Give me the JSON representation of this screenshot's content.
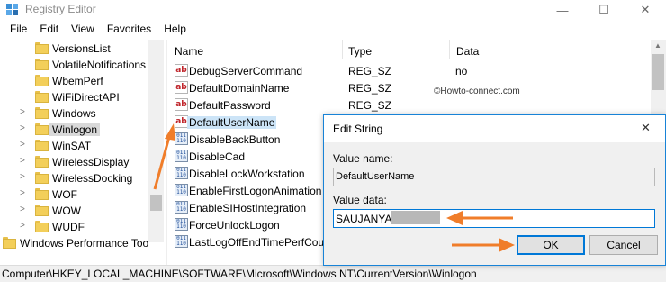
{
  "window": {
    "title": "Registry Editor",
    "controls": {
      "minimize": "—",
      "maximize": "☐",
      "close": "✕"
    }
  },
  "menu": [
    "File",
    "Edit",
    "View",
    "Favorites",
    "Help"
  ],
  "tree": {
    "items": [
      {
        "label": "VersionsList",
        "expandable": false,
        "selected": false
      },
      {
        "label": "VolatileNotifications",
        "expandable": false,
        "selected": false
      },
      {
        "label": "WbemPerf",
        "expandable": false,
        "selected": false
      },
      {
        "label": "WiFiDirectAPI",
        "expandable": false,
        "selected": false
      },
      {
        "label": "Windows",
        "expandable": true,
        "selected": false
      },
      {
        "label": "Winlogon",
        "expandable": true,
        "selected": true
      },
      {
        "label": "WinSAT",
        "expandable": true,
        "selected": false
      },
      {
        "label": "WirelessDisplay",
        "expandable": true,
        "selected": false
      },
      {
        "label": "WirelessDocking",
        "expandable": true,
        "selected": false
      },
      {
        "label": "WOF",
        "expandable": true,
        "selected": false
      },
      {
        "label": "WOW",
        "expandable": true,
        "selected": false
      },
      {
        "label": "WUDF",
        "expandable": true,
        "selected": false
      },
      {
        "label": "Windows Performance Too",
        "expandable": false,
        "selected": false
      }
    ]
  },
  "list": {
    "headers": {
      "name": "Name",
      "type": "Type",
      "data": "Data"
    },
    "rows": [
      {
        "name": "DebugServerCommand",
        "type": "REG_SZ",
        "data": "no",
        "icon": "string-value-icon"
      },
      {
        "name": "DefaultDomainName",
        "type": "REG_SZ",
        "data": "",
        "icon": "string-value-icon"
      },
      {
        "name": "DefaultPassword",
        "type": "REG_SZ",
        "data": "",
        "icon": "string-value-icon"
      },
      {
        "name": "DefaultUserName",
        "type": "",
        "data": "",
        "icon": "string-value-icon",
        "selected": true
      },
      {
        "name": "DisableBackButton",
        "type": "",
        "data": "",
        "icon": "binary-value-icon"
      },
      {
        "name": "DisableCad",
        "type": "",
        "data": "",
        "icon": "binary-value-icon"
      },
      {
        "name": "DisableLockWorkstation",
        "type": "",
        "data": "",
        "icon": "binary-value-icon"
      },
      {
        "name": "EnableFirstLogonAnimation",
        "type": "",
        "data": "",
        "icon": "binary-value-icon"
      },
      {
        "name": "EnableSIHostIntegration",
        "type": "",
        "data": "",
        "icon": "binary-value-icon"
      },
      {
        "name": "ForceUnlockLogon",
        "type": "",
        "data": "",
        "icon": "binary-value-icon"
      },
      {
        "name": "LastLogOffEndTimePerfCou",
        "type": "",
        "data": "",
        "icon": "binary-value-icon"
      }
    ]
  },
  "watermark": "©Howto-connect.com",
  "status": {
    "path": "Computer\\HKEY_LOCAL_MACHINE\\SOFTWARE\\Microsoft\\Windows NT\\CurrentVersion\\Winlogon"
  },
  "dialog": {
    "title": "Edit String",
    "close": "✕",
    "value_name_label": "Value name:",
    "value_name": "DefaultUserName",
    "value_data_label": "Value data:",
    "value_data": "SAUJANYA",
    "ok_label": "OK",
    "cancel_label": "Cancel"
  },
  "colors": {
    "accent": "#0078d7",
    "annotation_arrow": "#f07d2a",
    "selection": "#cce4f7",
    "folder": "#f3cf5a"
  }
}
